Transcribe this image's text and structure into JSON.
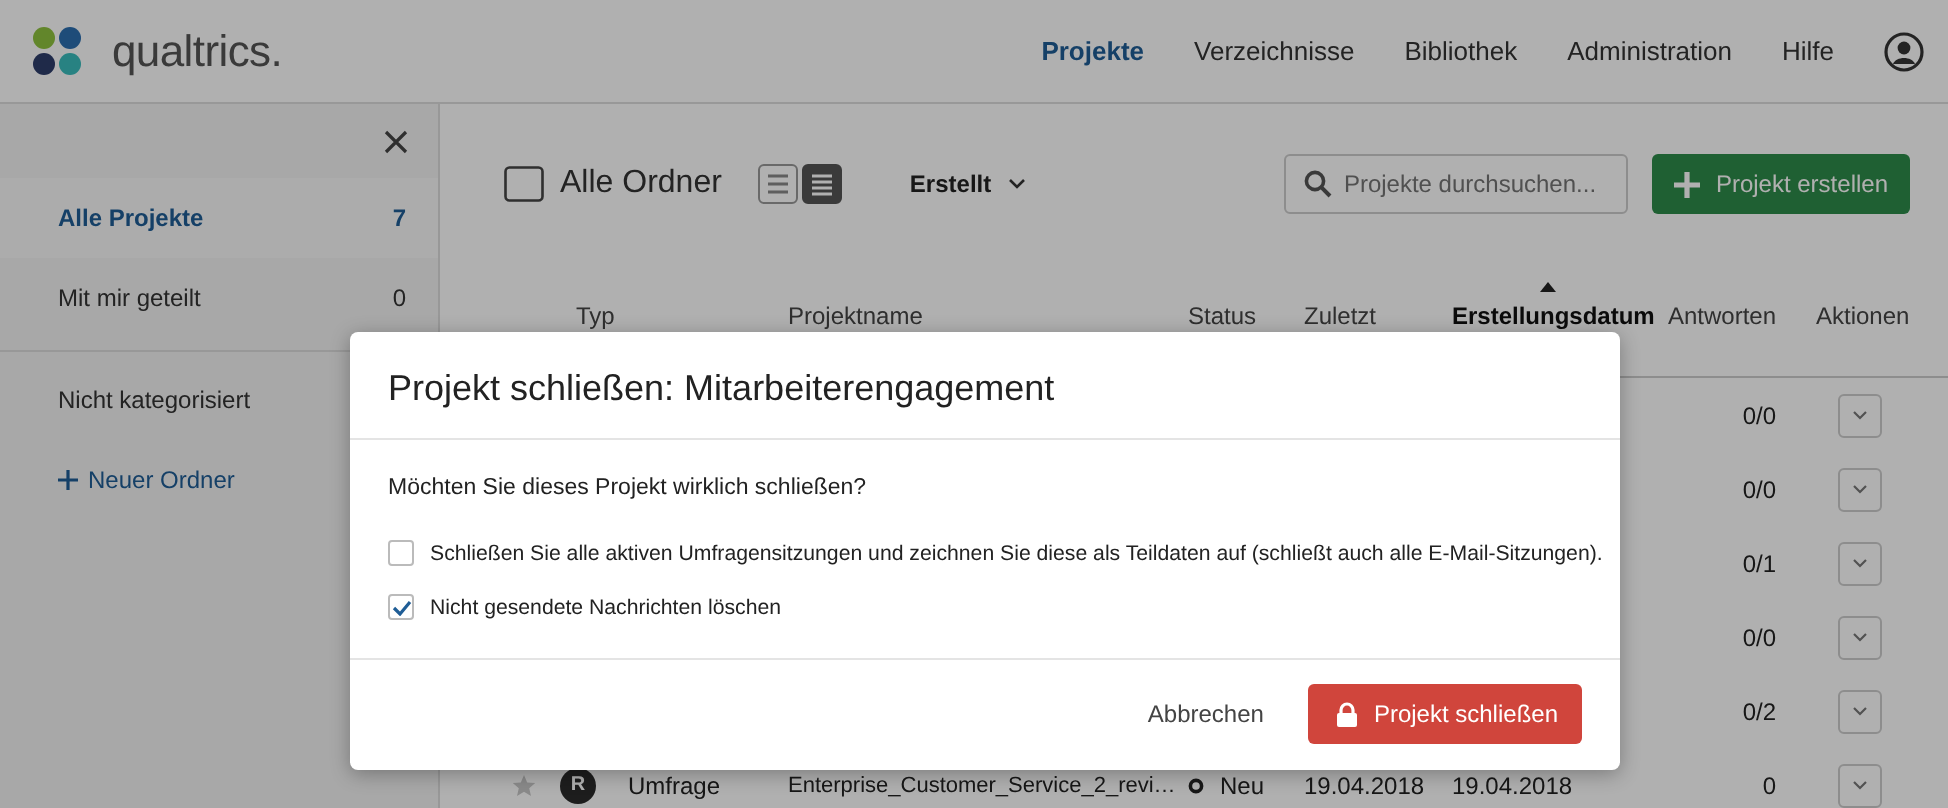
{
  "header": {
    "logo_text": "qualtrics.",
    "nav": [
      {
        "label": "Projekte",
        "selected": true
      },
      {
        "label": "Verzeichnisse",
        "selected": false
      },
      {
        "label": "Bibliothek",
        "selected": false
      },
      {
        "label": "Administration",
        "selected": false
      },
      {
        "label": "Hilfe",
        "selected": false
      }
    ]
  },
  "sidebar": {
    "items": [
      {
        "label": "Alle Projekte",
        "count": "7",
        "selected": true
      },
      {
        "label": "Mit mir geteilt",
        "count": "0",
        "selected": false
      }
    ],
    "uncategorized": "Nicht kategorisiert",
    "new_folder": "Neuer Ordner"
  },
  "toolbar": {
    "folder": "Alle Ordner",
    "view_buttons": [
      {
        "selected": false
      },
      {
        "selected": true
      }
    ],
    "sort": "Erstellt",
    "search_placeholder": "Projekte durchsuchen...",
    "create_button": "Projekt erstellen"
  },
  "table": {
    "columns": [
      {
        "label": "Typ",
        "sorted": false
      },
      {
        "label": "Projektname",
        "sorted": false
      },
      {
        "label": "Status",
        "sorted": false
      },
      {
        "label": "Zuletzt",
        "sorted": false
      },
      {
        "label": "Erstellungsdatum",
        "sorted": true
      },
      {
        "label": "Antworten",
        "sorted": false
      },
      {
        "label": "Aktionen",
        "sorted": false
      }
    ],
    "rows": [
      {
        "answers": "0/0"
      },
      {
        "answers": "0/0"
      },
      {
        "answers": "0/1"
      },
      {
        "answers": "0/0"
      },
      {
        "answers": "0/2"
      },
      {
        "starred": false,
        "type_badge": "R",
        "type": "Umfrage",
        "name": "Enterprise_Customer_Service_2_revi…",
        "status": "Neu",
        "last_modified": "19.04.2018",
        "created": "19.04.2018",
        "answers": "0"
      }
    ]
  },
  "dialog": {
    "title": "Projekt schließen: Mitarbeiterengagement",
    "question": "Möchten Sie dieses Projekt wirklich schließen?",
    "options": [
      {
        "label": "Schließen Sie alle aktiven Umfragensitzungen und zeichnen Sie diese als Teildaten auf (schließt auch alle E-Mail-Sitzungen).",
        "checked": false
      },
      {
        "label": "Nicht gesendete Nachrichten löschen",
        "checked": true
      }
    ],
    "cancel": "Abbrechen",
    "confirm": "Projekt schließen"
  }
}
